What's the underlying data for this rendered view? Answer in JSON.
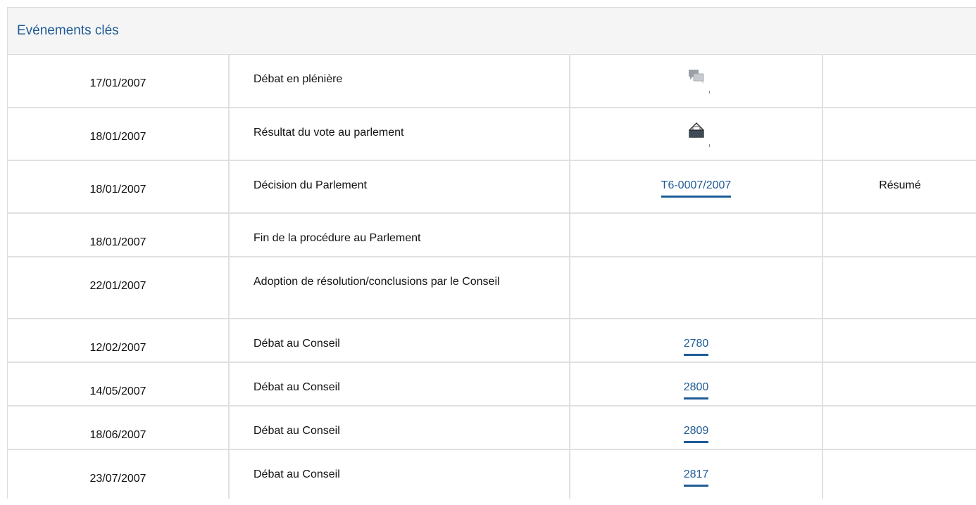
{
  "panel": {
    "title": "Evénements clés"
  },
  "rows": [
    {
      "date": "17/01/2007",
      "event": "Débat en plénière",
      "doc_icon": "debate-speech-bubbles-icon",
      "summary": ""
    },
    {
      "date": "18/01/2007",
      "event": "Résultat du vote au parlement",
      "doc_icon": "vote-ballot-box-icon",
      "summary": ""
    },
    {
      "date": "18/01/2007",
      "event": "Décision du Parlement",
      "doc": "T6-0007/2007",
      "summary": "Résumé"
    },
    {
      "date": "18/01/2007",
      "event": "Fin de la procédure au Parlement",
      "summary": ""
    },
    {
      "date": "22/01/2007",
      "event": "Adoption de résolution/conclusions par le Conseil",
      "summary": ""
    },
    {
      "date": "12/02/2007",
      "event": "Débat au Conseil",
      "doc": "2780",
      "summary": ""
    },
    {
      "date": "14/05/2007",
      "event": "Débat au Conseil",
      "doc": "2800",
      "summary": ""
    },
    {
      "date": "18/06/2007",
      "event": "Débat au Conseil",
      "doc": "2809",
      "summary": ""
    },
    {
      "date": "23/07/2007",
      "event": "Débat au Conseil",
      "doc": "2817",
      "summary": ""
    }
  ],
  "colors": {
    "link": "#1f5b96",
    "header_bg": "#f5f5f5",
    "border": "#e0e0e0"
  }
}
